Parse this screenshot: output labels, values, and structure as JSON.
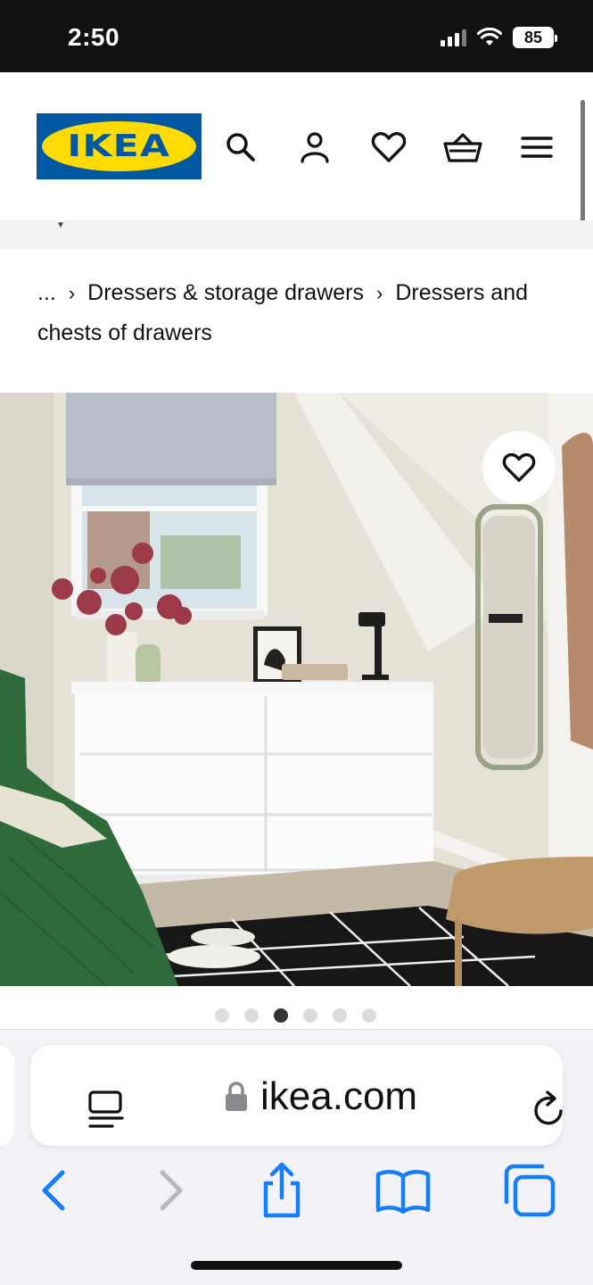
{
  "status_bar": {
    "time": "2:50",
    "battery": "85"
  },
  "header": {
    "logo_text": "IKEA",
    "icons": [
      "search-icon",
      "profile-icon",
      "heart-icon",
      "basket-icon",
      "menu-icon"
    ]
  },
  "breadcrumb": {
    "items": [
      "...",
      "Dressers & storage drawers",
      "Dressers and chests of drawers"
    ]
  },
  "carousel": {
    "total": 6,
    "active": 3
  },
  "browser": {
    "url": "ikea.com"
  },
  "colors": {
    "ikea_blue": "#0058a3",
    "ikea_yellow": "#ffdb00",
    "safari_blue": "#147efb"
  }
}
